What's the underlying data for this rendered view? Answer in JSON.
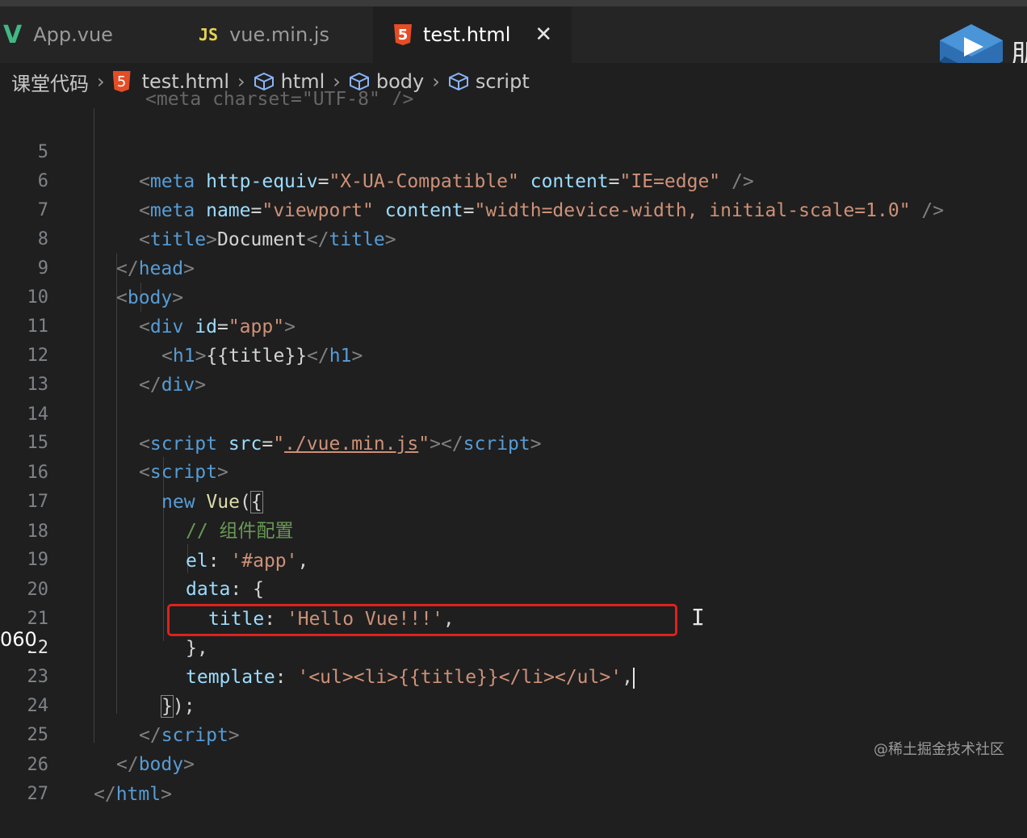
{
  "tabs": [
    {
      "icon": "V",
      "label": "App.vue"
    },
    {
      "icon": "JS",
      "label": "vue.min.js"
    },
    {
      "icon": "5",
      "label": "test.html",
      "close": "✕"
    }
  ],
  "breadcrumb": {
    "root": "课堂代码",
    "file": "test.html",
    "items": [
      "html",
      "body",
      "script"
    ]
  },
  "logo": {
    "partial_char": "朋"
  },
  "editor": {
    "peek": "<meta charset=\"UTF-8\" />",
    "lines": {
      "5": {
        "n": "5"
      },
      "6": {
        "n": "6"
      },
      "7": {
        "n": "7"
      },
      "8": {
        "n": "8"
      },
      "9": {
        "n": "9"
      },
      "10": {
        "n": "10"
      },
      "11": {
        "n": "11"
      },
      "12": {
        "n": "12"
      },
      "13": {
        "n": "13"
      },
      "14": {
        "n": "14"
      },
      "15": {
        "n": "15"
      },
      "16": {
        "n": "16"
      },
      "17": {
        "n": "17"
      },
      "18": {
        "n": "18"
      },
      "19": {
        "n": "19"
      },
      "20": {
        "n": "20"
      },
      "21": {
        "n": "21"
      },
      "22": {
        "n": "22"
      },
      "23": {
        "n": "23"
      },
      "24": {
        "n": "24"
      },
      "25": {
        "n": "25"
      },
      "26": {
        "n": "26"
      },
      "27": {
        "n": "27"
      }
    },
    "code": {
      "l7_text": "Document",
      "l11_text": "{{title}}",
      "l16_new": "new",
      "l16_vue": "Vue",
      "l17_comment": "// 组件配置",
      "l18_key": "el",
      "l18_val": "'#app'",
      "l19_key": "data",
      "l20_key": "title",
      "l20_val": "'Hello Vue!!!'",
      "l22_key": "template",
      "l22_val": "'<ul><li>{{title}}</li></ul>'",
      "l14_src": "./vue.min.js"
    }
  },
  "overlay": {
    "side_number": "060"
  },
  "watermark": "@稀土掘金技术社区"
}
